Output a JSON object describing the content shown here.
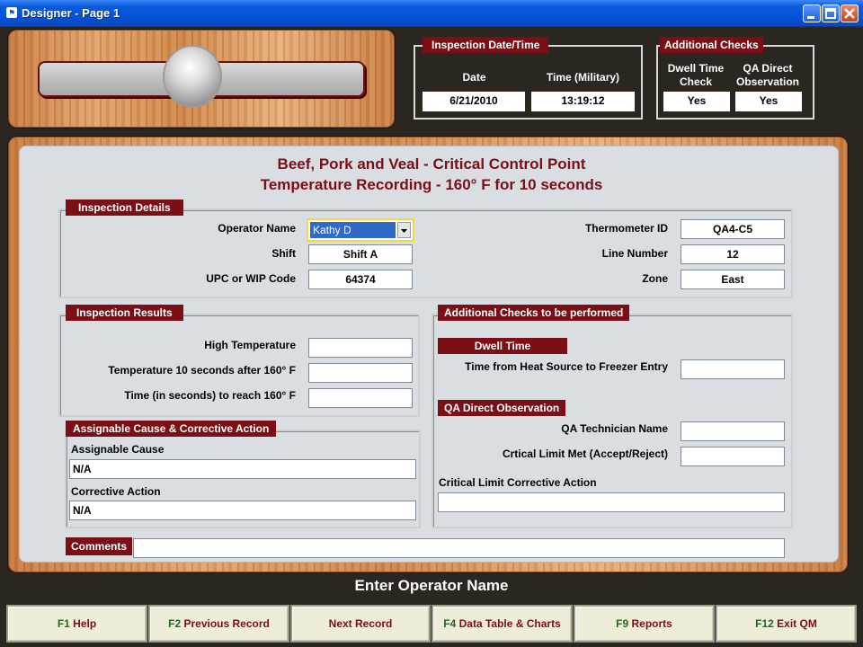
{
  "window": {
    "title": "Designer - Page 1"
  },
  "colors": {
    "accent": "#7a0f16",
    "title_bar": "#0a5ae0",
    "field_bg": "#ffffff",
    "selection": "#3169c6"
  },
  "header": {
    "inspection_datetime": {
      "heading": "Inspection Date/Time",
      "date_label": "Date",
      "date_value": "6/21/2010",
      "time_label": "Time (Military)",
      "time_value": "13:19:12"
    },
    "additional_checks": {
      "heading": "Additional Checks",
      "dwell_label_1": "Dwell Time",
      "dwell_label_2": "Check",
      "dwell_value": "Yes",
      "qa_label_1": "QA Direct",
      "qa_label_2": "Observation",
      "qa_value": "Yes"
    }
  },
  "form": {
    "title_line1": "Beef, Pork and Veal - Critical Control Point",
    "title_line2": "Temperature Recording - 160° F for 10 seconds",
    "inspection_details": {
      "heading": "Inspection Details",
      "operator_label": "Operator Name",
      "operator_value": "Kathy D",
      "shift_label": "Shift",
      "shift_value": "Shift A",
      "upc_label": "UPC or WIP Code",
      "upc_value": "64374",
      "thermometer_label": "Thermometer ID",
      "thermometer_value": "QA4-C5",
      "line_label": "Line Number",
      "line_value": "12",
      "zone_label": "Zone",
      "zone_value": "East"
    },
    "inspection_results": {
      "heading": "Inspection Results",
      "high_temp_label": "High Temperature",
      "high_temp_value": "",
      "temp_after_label": "Temperature 10 seconds after 160° F",
      "temp_after_value": "",
      "time_to_reach_label": "Time (in seconds) to reach 160° F",
      "time_to_reach_value": ""
    },
    "assignable_cause": {
      "heading": "Assignable Cause & Corrective Action",
      "cause_label": "Assignable Cause",
      "cause_value": "N/A",
      "action_label": "Corrective Action",
      "action_value": "N/A"
    },
    "additional_checks_performed": {
      "heading": "Additional Checks to be performed",
      "dwell_heading": "Dwell Time",
      "heat_to_freezer_label": "Time from Heat Source to Freezer Entry",
      "heat_to_freezer_value": "",
      "qa_heading": "QA Direct Observation",
      "qa_tech_label": "QA Technician Name",
      "qa_tech_value": "",
      "critical_met_label": "Crtical Limit Met (Accept/Reject)",
      "critical_met_value": "",
      "critical_action_label": "Critical Limit Corrective Action",
      "critical_action_value": ""
    },
    "comments": {
      "label": "Comments",
      "value": ""
    }
  },
  "status": {
    "message": "Enter Operator Name"
  },
  "function_keys": [
    {
      "key": "F1",
      "label": "Help"
    },
    {
      "key": "F2",
      "label": "Previous Record"
    },
    {
      "key": "",
      "label": "Next Record"
    },
    {
      "key": "F4",
      "label": "Data Table & Charts"
    },
    {
      "key": "F9",
      "label": "Reports"
    },
    {
      "key": "F12",
      "label": "Exit QM"
    }
  ]
}
